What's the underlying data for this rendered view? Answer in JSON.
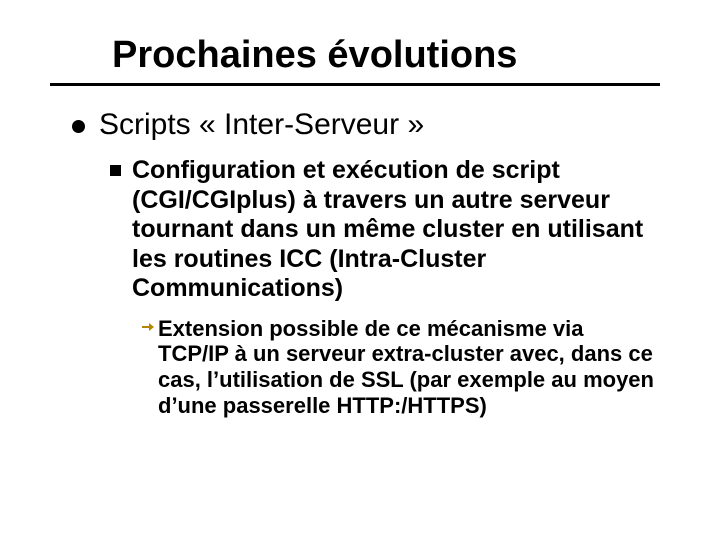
{
  "title": "Prochaines évolutions",
  "level1": {
    "text": "Scripts « Inter-Serveur »"
  },
  "level2": {
    "text": "Configuration et exécution de script (CGI/CGIplus) à travers un autre serveur tournant dans un même cluster en utilisant les routines ICC (Intra-Cluster Communications)"
  },
  "level3": {
    "text": "Extension possible de ce mécanisme via TCP/IP à un serveur extra-cluster avec, dans ce cas, l’utilisation de SSL (par exemple au moyen d’une passerelle HTTP:/HTTPS)"
  }
}
